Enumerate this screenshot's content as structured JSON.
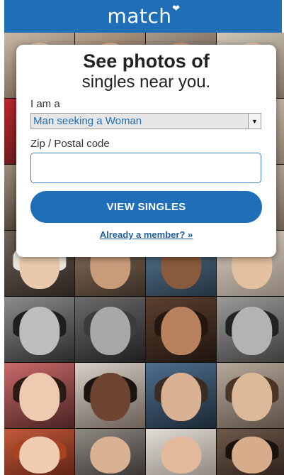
{
  "header": {
    "logo_text": "match",
    "logo_mark": "❤",
    "brand_color": "#1f6eb8"
  },
  "signup": {
    "headline": "See photos of",
    "subheadline": "singles near you.",
    "iam_label": "I am a",
    "seeking_selected": "Man seeking a Woman",
    "zip_label": "Zip / Postal code",
    "zip_value": "",
    "zip_placeholder": "",
    "cta_label": "VIEW SINGLES",
    "member_link": "Already a member? »"
  },
  "icons": {
    "select_arrow": "chevron-down-icon",
    "logo_heart": "heart-icon"
  }
}
